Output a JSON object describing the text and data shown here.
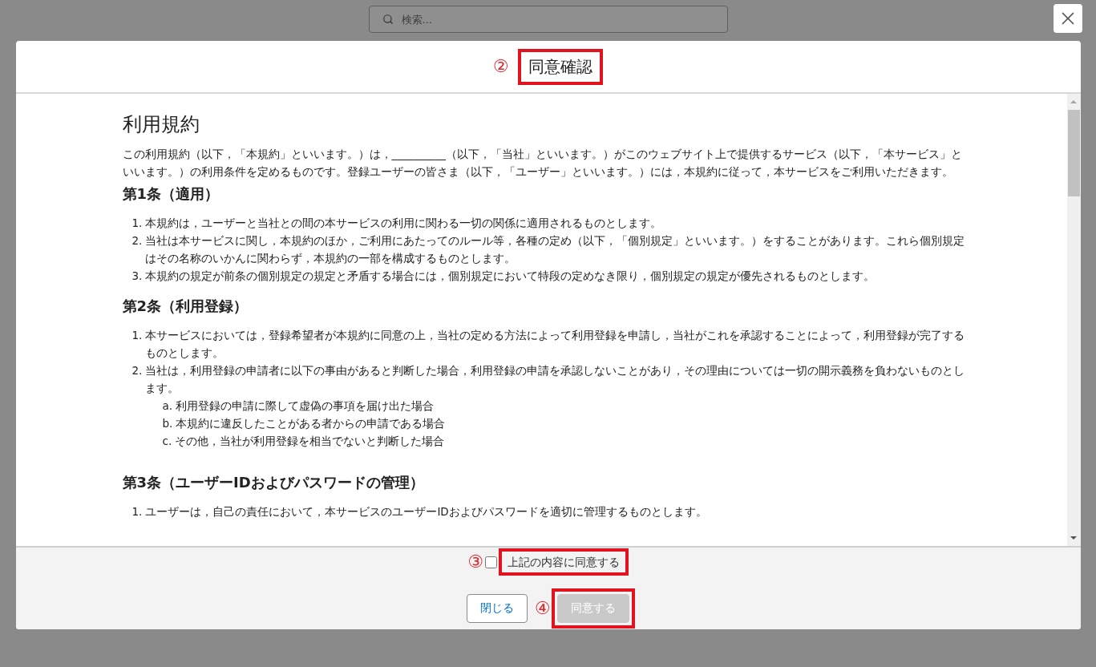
{
  "search": {
    "placeholder": "検索..."
  },
  "dialog": {
    "title": "同意確認",
    "title_marker": "②",
    "title_highlighted": true,
    "document": {
      "title": "利用規約",
      "intro": "この利用規約（以下，「本規約」といいます。）は，__________（以下，「当社」といいます。）がこのウェブサイト上で提供するサービス（以下，「本サービス」といいます。）の利用条件を定めるものです。登録ユーザーの皆さま（以下，「ユーザー」といいます。）には，本規約に従って，本サービスをご利用いただきます。",
      "articles": [
        {
          "heading": "第1条（適用）",
          "items": [
            {
              "number": "1.",
              "text": "本規約は，ユーザーと当社との間の本サービスの利用に関わる一切の関係に適用されるものとします。"
            },
            {
              "number": "2.",
              "text": "当社は本サービスに関し，本規約のほか，ご利用にあたってのルール等，各種の定め（以下，「個別規定」といいます。）をすることがあります。これら個別規定はその名称のいかんに関わらず，本規約の一部を構成するものとします。"
            },
            {
              "number": "3.",
              "text": "本規約の規定が前条の個別規定の規定と矛盾する場合には，個別規定において特段の定めなき限り，個別規定の規定が優先されるものとします。"
            }
          ]
        },
        {
          "heading": "第2条（利用登録）",
          "items": [
            {
              "number": "1.",
              "text": "本サービスにおいては，登録希望者が本規約に同意の上，当社の定める方法によって利用登録を申請し，当社がこれを承認することによって，利用登録が完了するものとします。"
            },
            {
              "number": "2.",
              "text": "当社は，利用登録の申請者に以下の事由があると判断した場合，利用登録の申請を承認しないことがあり，その理由については一切の開示義務を負わないものとします。",
              "children": [
                {
                  "number": "a.",
                  "text": "利用登録の申請に際して虚偽の事項を届け出た場合"
                },
                {
                  "number": "b.",
                  "text": "本規約に違反したことがある者からの申請である場合"
                },
                {
                  "number": "c.",
                  "text": "その他，当社が利用登録を相当でないと判断した場合"
                }
              ]
            }
          ]
        },
        {
          "heading": "第3条（ユーザーIDおよびパスワードの管理）",
          "items": [
            {
              "number": "1.",
              "text": "ユーザーは，自己の責任において，本サービスのユーザーIDおよびパスワードを適切に管理するものとします。"
            }
          ]
        }
      ]
    },
    "consent": {
      "marker": "③",
      "label": "上記の内容に同意する",
      "checked": false,
      "highlighted": true
    },
    "buttons": [
      {
        "kind": "secondary",
        "label": "閉じる",
        "disabled": false,
        "highlighted": false
      },
      {
        "kind": "primary",
        "label": "同意する",
        "disabled": true,
        "marker": "④",
        "highlighted": true
      }
    ]
  }
}
